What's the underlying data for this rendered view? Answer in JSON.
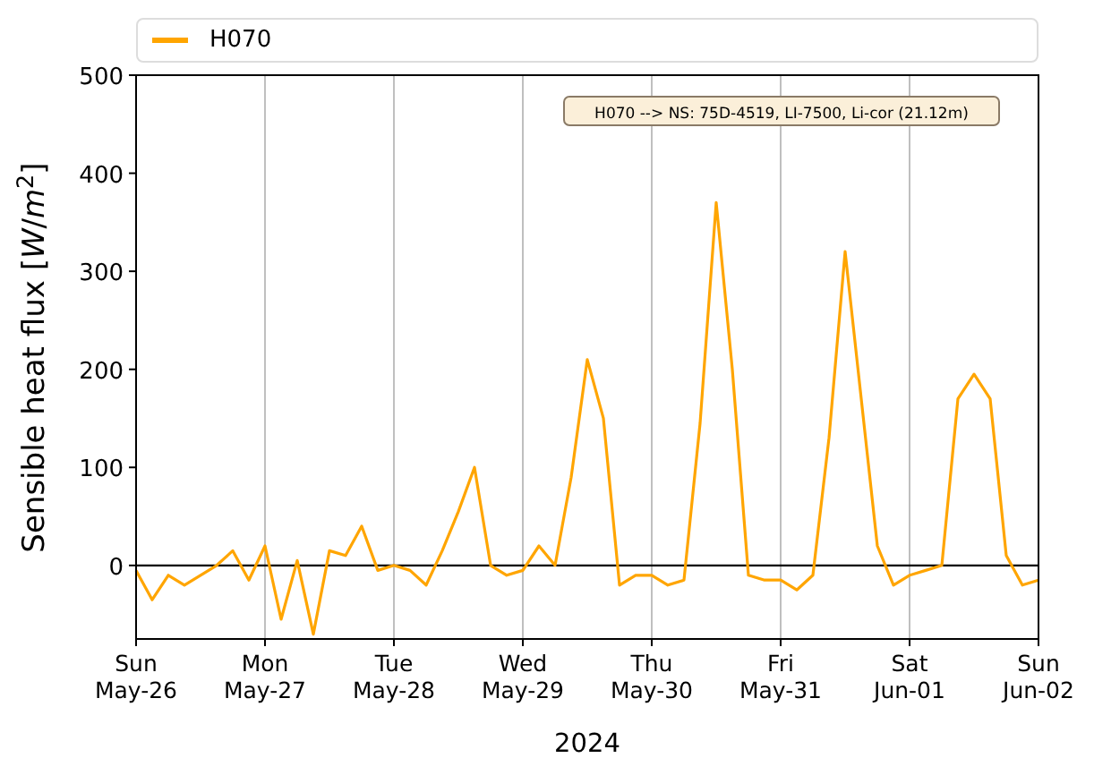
{
  "chart_data": {
    "type": "line",
    "xlabel": "2024",
    "ylabel": "Sensible heat flux [*W*/*m*$^{2}$]",
    "categories": [
      "Sun\nMay-26",
      null,
      null,
      null,
      null,
      null,
      null,
      null,
      "Mon\nMay-27",
      null,
      null,
      null,
      null,
      null,
      null,
      null,
      "Tue\nMay-28",
      null,
      null,
      null,
      null,
      null,
      null,
      null,
      "Wed\nMay-29",
      null,
      null,
      null,
      null,
      null,
      null,
      null,
      "Thu\nMay-30",
      null,
      null,
      null,
      null,
      null,
      null,
      null,
      "Fri\nMay-31",
      null,
      null,
      null,
      null,
      null,
      null,
      null,
      "Sat\nJun-01",
      null,
      null,
      null,
      null,
      null,
      null,
      null,
      "Sun\nJun-02"
    ],
    "series": [
      {
        "name": "H070",
        "color": "#ffa500",
        "values": [
          -5,
          -35,
          -10,
          -20,
          -10,
          0,
          15,
          -15,
          20,
          -55,
          5,
          -70,
          15,
          10,
          40,
          -5,
          0,
          -5,
          -20,
          15,
          55,
          100,
          0,
          -10,
          -5,
          20,
          0,
          90,
          210,
          150,
          -20,
          -10,
          -10,
          -20,
          -15,
          145,
          370,
          200,
          -10,
          -15,
          -15,
          -25,
          -10,
          130,
          320,
          170,
          20,
          -20,
          -10,
          -5,
          0,
          170,
          195,
          170,
          10,
          -20,
          -15
        ]
      }
    ],
    "grid": "x",
    "ylim": [
      -75,
      500
    ],
    "yticks": [
      0,
      100,
      200,
      300,
      400,
      500
    ],
    "annotations": [
      {
        "text": "H070 --> NS: 75D-4519, LI-7500, Li-cor (21.12m)"
      }
    ]
  }
}
